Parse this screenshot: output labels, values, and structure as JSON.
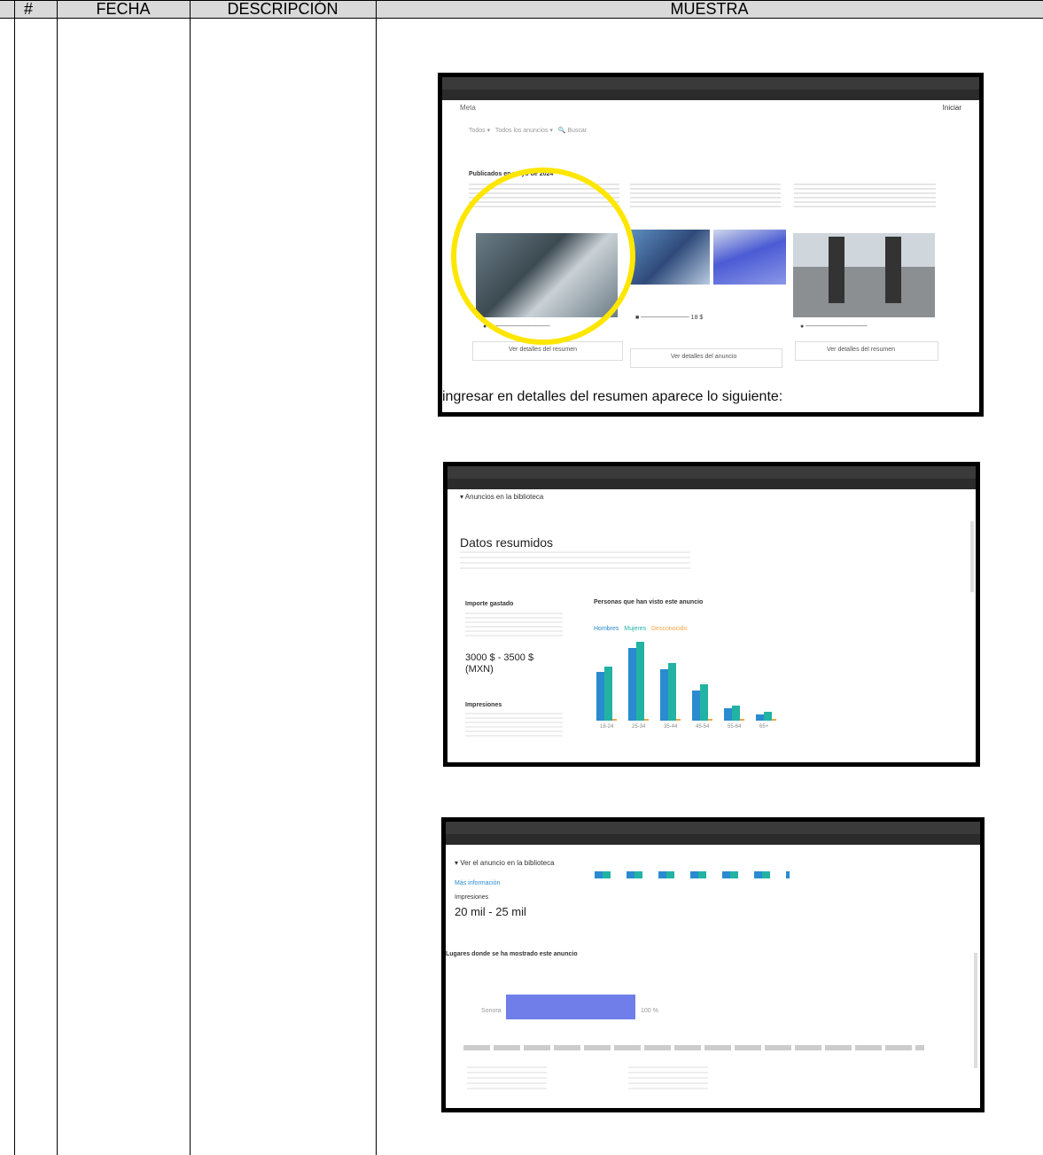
{
  "headers": {
    "num": "#",
    "date": "FECHA",
    "desc": "DESCRIPCIÓN",
    "sample": "MUESTRA"
  },
  "shot1": {
    "brand": "Meta",
    "top_link": "Iniciar",
    "filters": [
      "Todos",
      "Todos los anuncios",
      "Buscar"
    ],
    "section_title": "Publicados en mayo de 2024",
    "card1_link": "Ver detalles del resumen",
    "card2_link": "Ver detalles del anuncio",
    "card3_link": "Ver detalles del resumen",
    "caption": "ingresar en detalles del resumen aparece lo siguiente:",
    "highlight_color": "#ffe600"
  },
  "shot2": {
    "page_heading": "Anuncios en la biblioteca",
    "title": "Datos resumidos",
    "spend_label": "Importe gastado",
    "spend_value": "3000 $ - 3500 $ (MXN)",
    "impressions_label": "Impresiones",
    "chart_title": "Personas que han visto este anuncio",
    "legend": [
      "Hombres",
      "Mujeres",
      "Desconocido"
    ],
    "ages": [
      "18-24",
      "25-34",
      "35-44",
      "45-54",
      "55-64",
      "65+"
    ]
  },
  "shot3": {
    "heading": "Ver el anuncio en la biblioteca",
    "more_info": "Más información",
    "impressions_label": "Impresiones",
    "impressions_value": "20 mil - 25 mil",
    "region_title": "Lugares donde se ha mostrado este anuncio",
    "region_name": "Sonora",
    "region_value": "100 %"
  },
  "chart_data": {
    "type": "bar",
    "categories": [
      "18-24",
      "25-34",
      "35-44",
      "45-54",
      "55-64",
      "65+"
    ],
    "series": [
      {
        "name": "Hombres",
        "values": [
          16,
          24,
          17,
          10,
          4,
          2
        ]
      },
      {
        "name": "Mujeres",
        "values": [
          18,
          26,
          19,
          12,
          5,
          3
        ]
      },
      {
        "name": "Desconocido",
        "values": [
          0.5,
          0.5,
          0.5,
          0.5,
          0.5,
          0.5
        ]
      }
    ],
    "colors": [
      "#2a8bd0",
      "#22b3a3",
      "#f0a646"
    ]
  }
}
